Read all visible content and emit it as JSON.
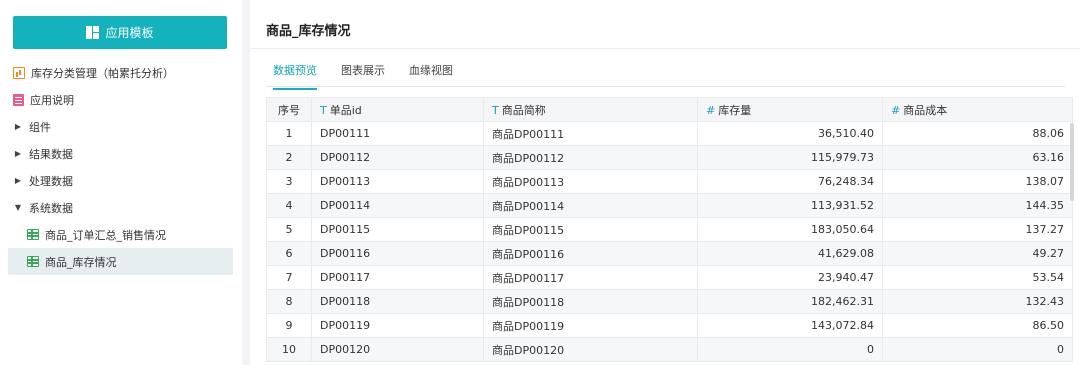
{
  "sidebar": {
    "app_button_label": "应用模板",
    "items": [
      {
        "label": "库存分类管理（帕累托分析）",
        "icon": "chart-icon"
      },
      {
        "label": "应用说明",
        "icon": "doc-icon"
      },
      {
        "label": "组件",
        "icon": "caret-right"
      },
      {
        "label": "结果数据",
        "icon": "caret-right"
      },
      {
        "label": "处理数据",
        "icon": "caret-right"
      },
      {
        "label": "系统数据",
        "icon": "caret-down"
      },
      {
        "label": "商品_订单汇总_销售情况",
        "icon": "table-icon"
      },
      {
        "label": "商品_库存情况",
        "icon": "table-icon"
      }
    ]
  },
  "main": {
    "title": "商品_库存情况",
    "tabs": [
      "数据预览",
      "图表展示",
      "血缘视图"
    ],
    "active_tab": 0
  },
  "table": {
    "columns": [
      {
        "label": "序号",
        "type": ""
      },
      {
        "label": "单品id",
        "type": "T"
      },
      {
        "label": "商品简称",
        "type": "T"
      },
      {
        "label": "库存量",
        "type": "#"
      },
      {
        "label": "商品成本",
        "type": "#"
      }
    ],
    "rows": [
      [
        "1",
        "DP00111",
        "商品DP00111",
        "36,510.40",
        "88.06"
      ],
      [
        "2",
        "DP00112",
        "商品DP00112",
        "115,979.73",
        "63.16"
      ],
      [
        "3",
        "DP00113",
        "商品DP00113",
        "76,248.34",
        "138.07"
      ],
      [
        "4",
        "DP00114",
        "商品DP00114",
        "113,931.52",
        "144.35"
      ],
      [
        "5",
        "DP00115",
        "商品DP00115",
        "183,050.64",
        "137.27"
      ],
      [
        "6",
        "DP00116",
        "商品DP00116",
        "41,629.08",
        "49.27"
      ],
      [
        "7",
        "DP00117",
        "商品DP00117",
        "23,940.47",
        "53.54"
      ],
      [
        "8",
        "DP00118",
        "商品DP00118",
        "182,462.31",
        "132.43"
      ],
      [
        "9",
        "DP00119",
        "商品DP00119",
        "143,072.84",
        "86.50"
      ],
      [
        "10",
        "DP00120",
        "商品DP00120",
        "0",
        "0"
      ]
    ]
  },
  "colors": {
    "accent": "#13b2bd",
    "selected_bg": "#e6eef2"
  }
}
